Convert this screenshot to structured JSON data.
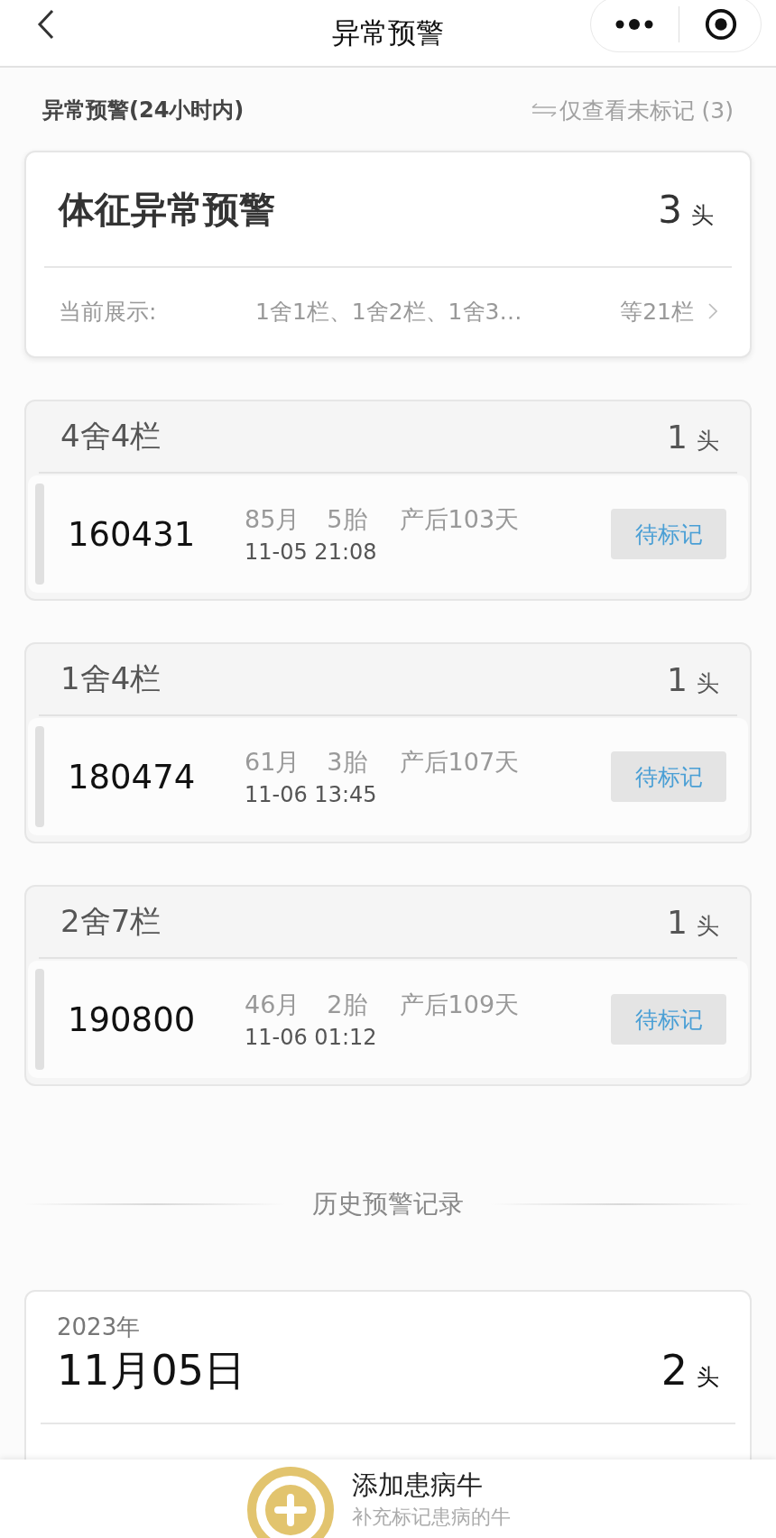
{
  "nav": {
    "title": "异常预警"
  },
  "section": {
    "title": "异常预警(24小时内)",
    "filter_link": "仅查看未标记 (3)"
  },
  "summary": {
    "title": "体征异常预警",
    "count": "3",
    "unit": "头",
    "display_label": "当前展示:",
    "display_value": "1舍1栏、1舍2栏、1舍3…",
    "display_more": "等21栏"
  },
  "groups": [
    {
      "pen": "4舍4栏",
      "count": "1",
      "unit": "头",
      "animals": [
        {
          "id": "160431",
          "age": "85月",
          "parity": "5胎",
          "days": "产后103天",
          "time": "11-05 21:08",
          "action": "待标记"
        }
      ]
    },
    {
      "pen": "1舍4栏",
      "count": "1",
      "unit": "头",
      "animals": [
        {
          "id": "180474",
          "age": "61月",
          "parity": "3胎",
          "days": "产后107天",
          "time": "11-06 13:45",
          "action": "待标记"
        }
      ]
    },
    {
      "pen": "2舍7栏",
      "count": "1",
      "unit": "头",
      "animals": [
        {
          "id": "190800",
          "age": "46月",
          "parity": "2胎",
          "days": "产后109天",
          "time": "11-06 01:12",
          "action": "待标记"
        }
      ]
    }
  ],
  "history": {
    "title": "历史预警记录",
    "days": [
      {
        "year": "2023年",
        "date": "11月05日",
        "count": "2",
        "unit": "头"
      }
    ]
  },
  "bottom_bar": {
    "title": "添加患病牛",
    "subtitle": "补充标记患病的牛"
  }
}
